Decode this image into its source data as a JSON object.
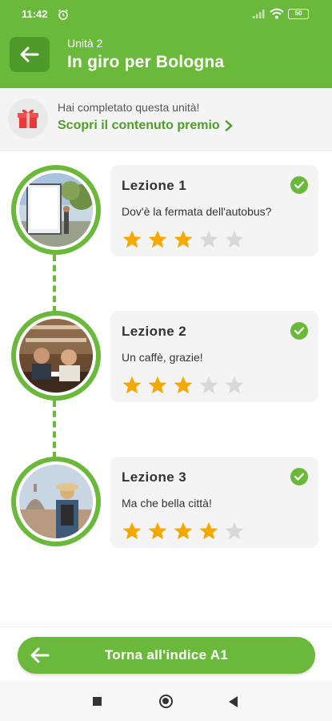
{
  "status_bar": {
    "time": "11:42",
    "battery": "50"
  },
  "header": {
    "unit": "Unità 2",
    "title": "In giro per Bologna"
  },
  "reward": {
    "message": "Hai completato questa unità!",
    "link": "Scopri il contenuto premio"
  },
  "lessons": [
    {
      "title": "Lezione 1",
      "subtitle": "Dov'è la fermata dell'autobus?",
      "completed": true,
      "rating": 3,
      "max_rating": 5
    },
    {
      "title": "Lezione 2",
      "subtitle": "Un caffè, grazie!",
      "completed": true,
      "rating": 3,
      "max_rating": 5
    },
    {
      "title": "Lezione 3",
      "subtitle": "Ma che bella città!",
      "completed": true,
      "rating": 4,
      "max_rating": 5
    }
  ],
  "footer": {
    "back_button": "Torna all'indice A1"
  },
  "colors": {
    "brand_green": "#6ab93b",
    "dark_green": "#4f9a29",
    "star_gold": "#f5a800",
    "star_empty": "#d8d8d8"
  },
  "icons": [
    "back-arrow-icon",
    "gift-icon",
    "chevron-right-icon",
    "check-icon",
    "star-icon",
    "alarm-icon",
    "signal-icon",
    "wifi-icon",
    "battery-icon"
  ]
}
